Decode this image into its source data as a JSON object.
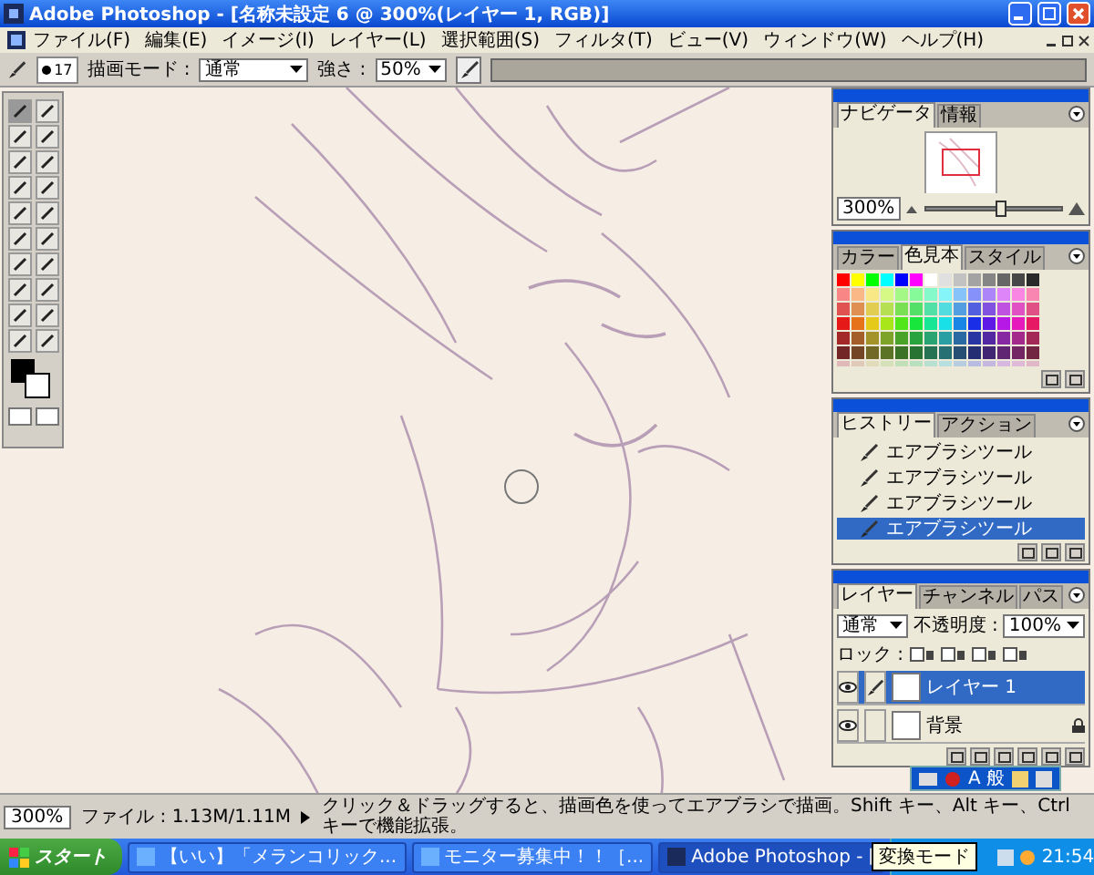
{
  "window": {
    "title": "Adobe Photoshop - [名称未設定 6 @ 300%(レイヤー 1, RGB)]"
  },
  "menu": [
    "ファイル(F)",
    "編集(E)",
    "イメージ(I)",
    "レイヤー(L)",
    "選択範囲(S)",
    "フィルタ(T)",
    "ビュー(V)",
    "ウィンドウ(W)",
    "ヘルプ(H)"
  ],
  "options_bar": {
    "brush_size": "17",
    "mode_label": "描画モード :",
    "mode_value": "通常",
    "strength_label": "強さ :",
    "strength_value": "50%"
  },
  "navigator": {
    "tabs": [
      {
        "label": "ナビゲータ",
        "selected": true
      },
      {
        "label": "情報",
        "selected": false
      }
    ],
    "zoom": "300%",
    "slider": {
      "level": 0.55
    }
  },
  "swatches": {
    "tabs": [
      {
        "label": "カラー",
        "selected": false
      },
      {
        "label": "色見本",
        "selected": true
      },
      {
        "label": "スタイル",
        "selected": false
      }
    ]
  },
  "history": {
    "tabs": [
      {
        "label": "ヒストリー",
        "selected": true
      },
      {
        "label": "アクション",
        "selected": false
      }
    ],
    "items": [
      {
        "label": "エアブラシツール",
        "selected": false
      },
      {
        "label": "エアブラシツール",
        "selected": false
      },
      {
        "label": "エアブラシツール",
        "selected": false
      },
      {
        "label": "エアブラシツール",
        "selected": true
      }
    ]
  },
  "layers": {
    "tabs": [
      {
        "label": "レイヤー",
        "selected": true
      },
      {
        "label": "チャンネル",
        "selected": false
      },
      {
        "label": "パス",
        "selected": false
      }
    ],
    "blend_mode": "通常",
    "opacity_label": "不透明度 :",
    "opacity_value": "100%",
    "lock_label": "ロック :",
    "locks": [
      {
        "checked": false
      },
      {
        "checked": false
      },
      {
        "checked": false
      },
      {
        "checked": false
      }
    ],
    "items": [
      {
        "name": "レイヤー 1",
        "selected": true,
        "visible": true,
        "locked": false
      },
      {
        "name": "背景",
        "selected": false,
        "visible": true,
        "locked": true
      }
    ]
  },
  "status_bar": {
    "zoom": "300%",
    "file_info": "ファイル : 1.13M/1.11M",
    "hint": "クリック＆ドラッグすると、描画色を使ってエアブラシで描画。Shift キー、Alt キー、Ctrl キーで機能拡張。"
  },
  "language_bar": {
    "input_mode": "A 般",
    "tooltip": "変換モード"
  },
  "taskbar": {
    "start": "スタート",
    "tasks": [
      {
        "label": "【いい】「メランコリック...",
        "selected": false
      },
      {
        "label": "モニター募集中！！［...",
        "selected": false
      },
      {
        "label": "Adobe Photoshop - [",
        "selected": true
      }
    ],
    "clock": "21:54"
  }
}
